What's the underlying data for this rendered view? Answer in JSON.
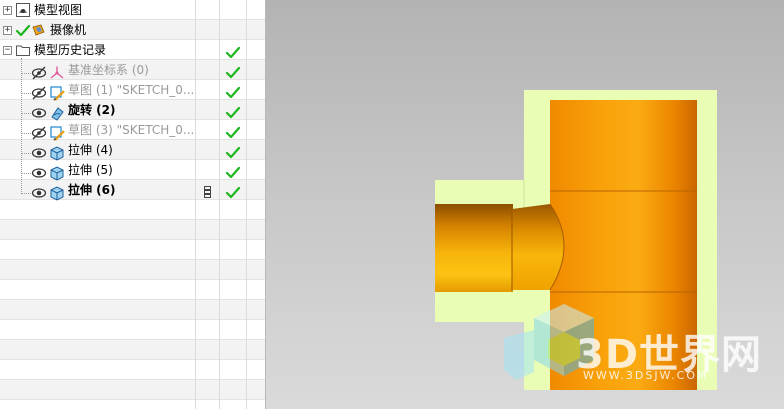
{
  "navigator": {
    "nodes": [
      {
        "label": "模型视图",
        "icon": "model-view-icon",
        "expander": "+",
        "checked": false,
        "dim": false,
        "bold": false
      },
      {
        "label": "摄像机",
        "icon": "camera-icon",
        "expander": "+",
        "checked": false,
        "dim": false,
        "bold": false
      },
      {
        "label": "模型历史记录",
        "icon": "folder-icon",
        "expander": "−",
        "checked": true,
        "dim": false,
        "bold": false
      },
      {
        "label": "基准坐标系 (0)",
        "icon": "datum-csys-icon",
        "checked": true,
        "dim": true,
        "bold": false,
        "hidden": true
      },
      {
        "label": "草图 (1) \"SKETCH_0...",
        "icon": "sketch-icon",
        "checked": true,
        "dim": true,
        "bold": false,
        "hidden": true
      },
      {
        "label": "旋转 (2)",
        "icon": "revolve-icon",
        "checked": true,
        "dim": false,
        "bold": true,
        "hidden": false
      },
      {
        "label": "草图 (3) \"SKETCH_0...",
        "icon": "sketch-icon",
        "checked": true,
        "dim": true,
        "bold": false,
        "hidden": true
      },
      {
        "label": "拉伸 (4)",
        "icon": "extrude-icon",
        "checked": true,
        "dim": false,
        "bold": false,
        "hidden": false
      },
      {
        "label": "拉伸 (5)",
        "icon": "extrude-icon",
        "checked": true,
        "dim": false,
        "bold": false,
        "hidden": false
      },
      {
        "label": "拉伸 (6)",
        "icon": "extrude-icon",
        "checked": true,
        "dim": false,
        "bold": true,
        "hidden": false,
        "extra": "latest-feature-icon"
      }
    ]
  },
  "viewport": {
    "watermark": {
      "text": "3D世界网",
      "url": "WWW.3DSJW.COM"
    }
  },
  "colors": {
    "check": "#1fb51f",
    "viewport_bg": "#c6c6c6",
    "section_fill": "#e9fdb4",
    "pipe_orange": "#f59a00"
  }
}
